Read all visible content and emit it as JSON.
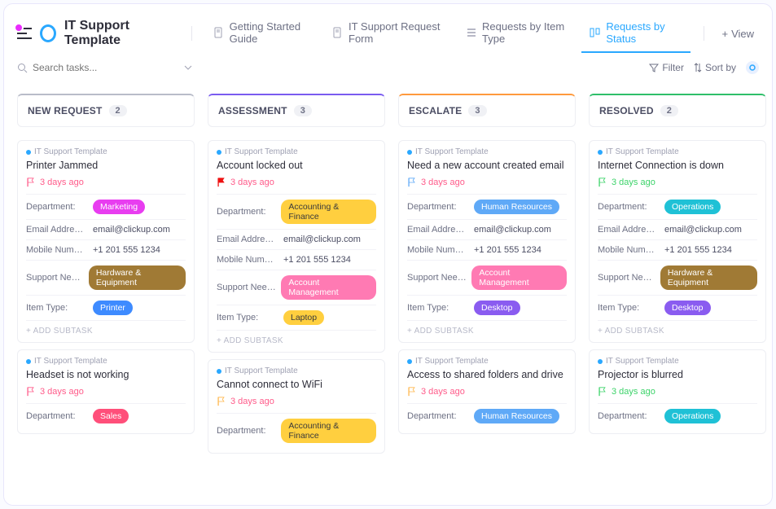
{
  "header": {
    "title": "IT Support Template",
    "tabs": [
      {
        "label": "Getting Started Guide"
      },
      {
        "label": "IT Support Request Form"
      },
      {
        "label": "Requests by Item Type"
      },
      {
        "label": "Requests by Status"
      }
    ],
    "add_view": "View"
  },
  "toolbar": {
    "search_placeholder": "Search tasks...",
    "filter": "Filter",
    "sort": "Sort by"
  },
  "colors": {
    "marketing": "#e83df0",
    "accounting": "#ffcf3f",
    "hr": "#5fa9f7",
    "operations": "#1fc1d6",
    "sales": "#ff4f7a",
    "hardware": "#a07a35",
    "account_mgmt": "#ff7ab3",
    "printer": "#3e8bff",
    "laptop": "#ffcf3f",
    "desktop": "#8a5cf0"
  },
  "fields": {
    "department": "Department:",
    "email": "Email Addre…",
    "mobile": "Mobile Num…",
    "support": "Support Nee…",
    "item_type": "Item Type:",
    "add_subtask": "+ ADD SUBTASK",
    "project": "IT Support Template"
  },
  "columns": [
    {
      "name": "NEW REQUEST",
      "count": "2",
      "accent": "#b9bcc9"
    },
    {
      "name": "ASSESSMENT",
      "count": "3",
      "accent": "#7a5cf0"
    },
    {
      "name": "ESCALATE",
      "count": "3",
      "accent": "#ff9a3d"
    },
    {
      "name": "RESOLVED",
      "count": "2",
      "accent": "#2fbf6a"
    }
  ],
  "cards": [
    [
      {
        "title": "Printer Jammed",
        "flag": "#ff5b8a",
        "age": "3 days ago",
        "dept": "Marketing",
        "dept_c": "marketing",
        "email": "email@clickup.com",
        "mobile": "+1 201 555 1234",
        "support": "Hardware & Equipment",
        "support_c": "hardware",
        "item": "Printer",
        "item_c": "printer"
      },
      {
        "title": "Headset is not working",
        "flag": "#ff5b8a",
        "age": "3 days ago",
        "dept": "Sales",
        "dept_c": "sales",
        "short": true
      }
    ],
    [
      {
        "title": "Account locked out",
        "flag": "#e11",
        "age": "3 days ago",
        "dept": "Accounting & Finance",
        "dept_c": "accounting",
        "dept_text": "#3a3a3a",
        "email": "email@clickup.com",
        "mobile": "+1 201 555 1234",
        "support": "Account Management",
        "support_c": "account_mgmt",
        "item": "Laptop",
        "item_c": "laptop",
        "item_text": "#3a3a3a"
      },
      {
        "title": "Cannot connect to WiFi",
        "flag": "#ffb84d",
        "age": "3 days ago",
        "dept": "Accounting & Finance",
        "dept_c": "accounting",
        "dept_text": "#3a3a3a",
        "short": true
      }
    ],
    [
      {
        "title": "Need a new account created email",
        "flag": "#5fa9f7",
        "age": "3 days ago",
        "dept": "Human Resources",
        "dept_c": "hr",
        "email": "email@clickup.com",
        "mobile": "+1 201 555 1234",
        "support": "Account Management",
        "support_c": "account_mgmt",
        "item": "Desktop",
        "item_c": "desktop"
      },
      {
        "title": "Access to shared folders and drive",
        "flag": "#ffb84d",
        "age": "3 days ago",
        "dept": "Human Resources",
        "dept_c": "hr",
        "short": true
      }
    ],
    [
      {
        "title": "Internet Connection is down",
        "flag": "#3dd36a",
        "age": "3 days ago",
        "age_c": "green",
        "dept": "Operations",
        "dept_c": "operations",
        "email": "email@clickup.com",
        "mobile": "+1 201 555 1234",
        "support": "Hardware & Equipment",
        "support_c": "hardware",
        "item": "Desktop",
        "item_c": "desktop"
      },
      {
        "title": "Projector is blurred",
        "flag": "#3dd36a",
        "age": "3 days ago",
        "age_c": "green",
        "dept": "Operations",
        "dept_c": "operations",
        "short": true
      }
    ]
  ]
}
